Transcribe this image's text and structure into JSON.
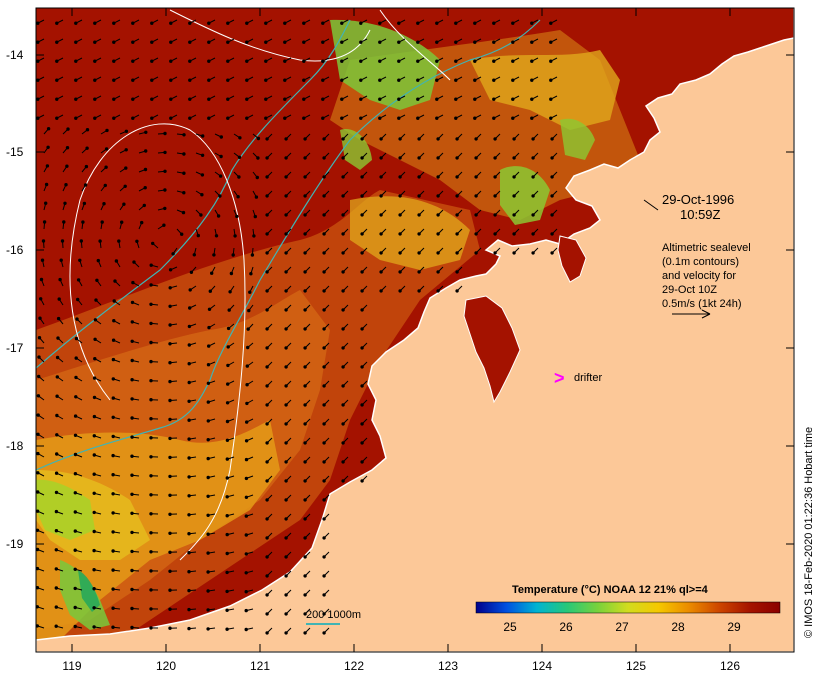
{
  "map": {
    "lat_ticks": [
      "-14",
      "-15",
      "-16",
      "-17",
      "-18",
      "-19"
    ],
    "lon_ticks": [
      "119",
      "120",
      "121",
      "122",
      "123",
      "124",
      "125",
      "126"
    ]
  },
  "annotation": {
    "date": "29-Oct-1996",
    "time": "10:59Z",
    "altimetry_lines": [
      "Altimetric sealevel",
      "(0.1m contours)",
      "and velocity for",
      "29-Oct 10Z",
      "0.5m/s (1kt 24h)"
    ],
    "drifter_symbol": ">",
    "drifter_label": "drifter"
  },
  "scale": {
    "isobath_label": "200 1000m"
  },
  "legend": {
    "title": "Temperature (°C) NOAA 12 21% ql>=4",
    "ticks": [
      "25",
      "26",
      "27",
      "28",
      "29"
    ],
    "colors": [
      "#00008b",
      "#0050e0",
      "#00b4d2",
      "#28c878",
      "#78d23c",
      "#d2dc1e",
      "#f5c800",
      "#eb8c00",
      "#cd4600",
      "#a51400",
      "#8b0000"
    ]
  },
  "credit": "© IMOS 18-Feb-2020 01:22:36 Hobart time",
  "colors": {
    "land": "#fcc898",
    "sea_warm": "#a41200",
    "sea_mid": "#c44a0c",
    "sea_cool": "#e49a18",
    "sea_green": "#8cc832",
    "contour": "#ffffff",
    "isobath": "#40b4b4",
    "drifter": "#ff00ff"
  }
}
